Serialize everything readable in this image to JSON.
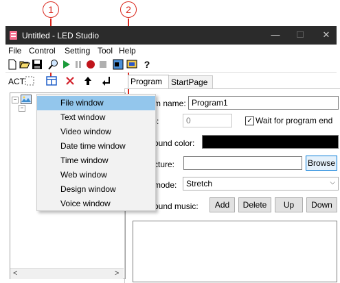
{
  "callouts": [
    "1",
    "2"
  ],
  "window": {
    "title": "Untitled - LED Studio",
    "controls": {
      "minimize": "—",
      "maximize": "☐",
      "close": "✕"
    }
  },
  "menu": [
    "File",
    "Control",
    "Setting",
    "Tool",
    "Help"
  ],
  "toolbar_icons": [
    "new-icon",
    "open-icon",
    "save-icon",
    "search-icon",
    "play-icon",
    "pause-icon",
    "record-icon",
    "stop-icon",
    "window-icon",
    "screen-icon",
    "help-icon"
  ],
  "left_toolbar": {
    "act_label": "ACT",
    "icons": [
      "select-icon",
      "add-window-icon",
      "delete-icon",
      "move-up-icon",
      "move-down-icon"
    ]
  },
  "context_menu": {
    "items": [
      "File window",
      "Text window",
      "Video window",
      "Date time window",
      "Time window",
      "Web window",
      "Design window",
      "Voice window"
    ],
    "highlighted": "File window"
  },
  "tabs": [
    "Program",
    "StartPage"
  ],
  "form": {
    "name_label": "m name:",
    "name_value": "Program1",
    "duration_label": "):",
    "duration_value": "0",
    "wait_label": "Wait for program end",
    "wait_checked": true,
    "bgcolor_label": "ound color:",
    "bgcolor_value": "#000000",
    "picture_label": "cture:",
    "picture_value": "",
    "browse_label": "Browse",
    "mode_label": "mode:",
    "mode_value": "Stretch",
    "music_label": "ound music:",
    "music_buttons": [
      "Add",
      "Delete",
      "Up",
      "Down"
    ]
  },
  "scroll": {
    "left_arrow": "<",
    "right_arrow": ">"
  },
  "colors": {
    "titlebar": "#2b2b2b",
    "highlight": "#93c6ec",
    "callout": "#d9261c"
  }
}
